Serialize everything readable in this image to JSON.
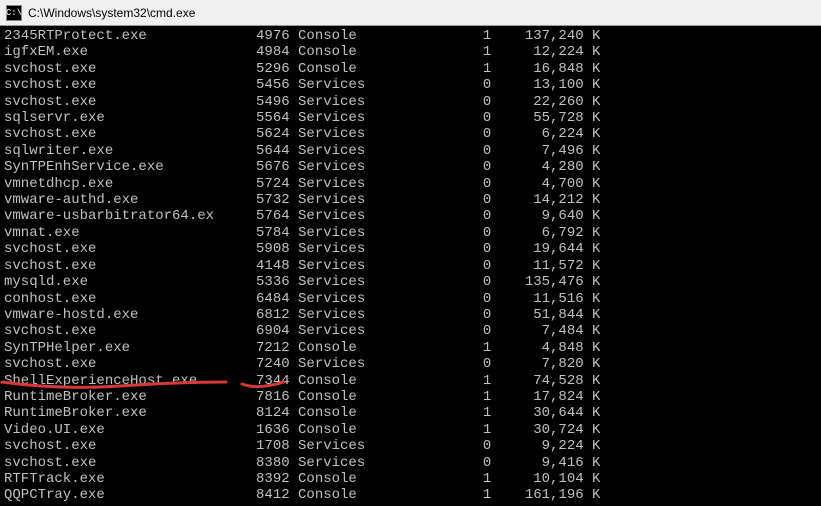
{
  "window": {
    "title": "C:\\Windows\\system32\\cmd.exe",
    "icon": "cmd-icon"
  },
  "processes": [
    {
      "name": "2345RTProtect.exe",
      "pid": 4976,
      "session_name": "Console",
      "session_num": 1,
      "mem": "137,240",
      "unit": "K"
    },
    {
      "name": "igfxEM.exe",
      "pid": 4984,
      "session_name": "Console",
      "session_num": 1,
      "mem": "12,224",
      "unit": "K"
    },
    {
      "name": "svchost.exe",
      "pid": 5296,
      "session_name": "Console",
      "session_num": 1,
      "mem": "16,848",
      "unit": "K"
    },
    {
      "name": "svchost.exe",
      "pid": 5456,
      "session_name": "Services",
      "session_num": 0,
      "mem": "13,100",
      "unit": "K"
    },
    {
      "name": "svchost.exe",
      "pid": 5496,
      "session_name": "Services",
      "session_num": 0,
      "mem": "22,260",
      "unit": "K"
    },
    {
      "name": "sqlservr.exe",
      "pid": 5564,
      "session_name": "Services",
      "session_num": 0,
      "mem": "55,728",
      "unit": "K"
    },
    {
      "name": "svchost.exe",
      "pid": 5624,
      "session_name": "Services",
      "session_num": 0,
      "mem": "6,224",
      "unit": "K"
    },
    {
      "name": "sqlwriter.exe",
      "pid": 5644,
      "session_name": "Services",
      "session_num": 0,
      "mem": "7,496",
      "unit": "K"
    },
    {
      "name": "SynTPEnhService.exe",
      "pid": 5676,
      "session_name": "Services",
      "session_num": 0,
      "mem": "4,280",
      "unit": "K"
    },
    {
      "name": "vmnetdhcp.exe",
      "pid": 5724,
      "session_name": "Services",
      "session_num": 0,
      "mem": "4,700",
      "unit": "K"
    },
    {
      "name": "vmware-authd.exe",
      "pid": 5732,
      "session_name": "Services",
      "session_num": 0,
      "mem": "14,212",
      "unit": "K"
    },
    {
      "name": "vmware-usbarbitrator64.ex",
      "pid": 5764,
      "session_name": "Services",
      "session_num": 0,
      "mem": "9,640",
      "unit": "K"
    },
    {
      "name": "vmnat.exe",
      "pid": 5784,
      "session_name": "Services",
      "session_num": 0,
      "mem": "6,792",
      "unit": "K"
    },
    {
      "name": "svchost.exe",
      "pid": 5908,
      "session_name": "Services",
      "session_num": 0,
      "mem": "19,644",
      "unit": "K"
    },
    {
      "name": "svchost.exe",
      "pid": 4148,
      "session_name": "Services",
      "session_num": 0,
      "mem": "11,572",
      "unit": "K"
    },
    {
      "name": "mysqld.exe",
      "pid": 5336,
      "session_name": "Services",
      "session_num": 0,
      "mem": "135,476",
      "unit": "K"
    },
    {
      "name": "conhost.exe",
      "pid": 6484,
      "session_name": "Services",
      "session_num": 0,
      "mem": "11,516",
      "unit": "K"
    },
    {
      "name": "vmware-hostd.exe",
      "pid": 6812,
      "session_name": "Services",
      "session_num": 0,
      "mem": "51,844",
      "unit": "K"
    },
    {
      "name": "svchost.exe",
      "pid": 6904,
      "session_name": "Services",
      "session_num": 0,
      "mem": "7,484",
      "unit": "K"
    },
    {
      "name": "SynTPHelper.exe",
      "pid": 7212,
      "session_name": "Console",
      "session_num": 1,
      "mem": "4,848",
      "unit": "K"
    },
    {
      "name": "svchost.exe",
      "pid": 7240,
      "session_name": "Services",
      "session_num": 0,
      "mem": "7,820",
      "unit": "K"
    },
    {
      "name": "ShellExperienceHost.exe",
      "pid": 7344,
      "session_name": "Console",
      "session_num": 1,
      "mem": "74,528",
      "unit": "K"
    },
    {
      "name": "RuntimeBroker.exe",
      "pid": 7816,
      "session_name": "Console",
      "session_num": 1,
      "mem": "17,824",
      "unit": "K"
    },
    {
      "name": "RuntimeBroker.exe",
      "pid": 8124,
      "session_name": "Console",
      "session_num": 1,
      "mem": "30,644",
      "unit": "K"
    },
    {
      "name": "Video.UI.exe",
      "pid": 1636,
      "session_name": "Console",
      "session_num": 1,
      "mem": "30,724",
      "unit": "K"
    },
    {
      "name": "svchost.exe",
      "pid": 1708,
      "session_name": "Services",
      "session_num": 0,
      "mem": "9,224",
      "unit": "K"
    },
    {
      "name": "svchost.exe",
      "pid": 8380,
      "session_name": "Services",
      "session_num": 0,
      "mem": "9,416",
      "unit": "K"
    },
    {
      "name": "RTFTrack.exe",
      "pid": 8392,
      "session_name": "Console",
      "session_num": 1,
      "mem": "10,104",
      "unit": "K"
    },
    {
      "name": "QQPCTray.exe",
      "pid": 8412,
      "session_name": "Console",
      "session_num": 1,
      "mem": "161,196",
      "unit": "K"
    }
  ],
  "annotation_color": "#d73838"
}
